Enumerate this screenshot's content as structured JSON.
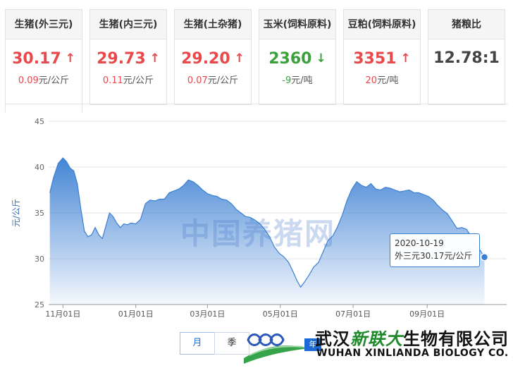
{
  "cards": [
    {
      "label": "生猪(外三元)",
      "price": "30.17",
      "direction": "up",
      "delta": "0.09",
      "unit": "元/公斤"
    },
    {
      "label": "生猪(内三元)",
      "price": "29.73",
      "direction": "up",
      "delta": "0.11",
      "unit": "元/公斤"
    },
    {
      "label": "生猪(土杂猪)",
      "price": "29.20",
      "direction": "up",
      "delta": "0.07",
      "unit": "元/公斤"
    },
    {
      "label": "玉米(饲料原料)",
      "price": "2360",
      "direction": "down",
      "delta": "-9",
      "unit": "元/吨"
    },
    {
      "label": "豆粕(饲料原料)",
      "price": "3351",
      "direction": "up",
      "delta": "20",
      "unit": "元/吨"
    },
    {
      "label": "猪粮比",
      "price": "12.78:1",
      "direction": "none",
      "delta": "",
      "unit": ""
    }
  ],
  "icons": {
    "up": "arrow-up-icon",
    "down": "arrow-down-icon"
  },
  "colors": {
    "up": "#e8494c",
    "down": "#3aa13c",
    "line": "#3b7fd3",
    "fill_top": "#3b7fd3",
    "fill_bottom": "#ffffff"
  },
  "watermark": "中国养猪网",
  "tooltip": {
    "date": "2020-10-19",
    "text": "外三元30.17元/公斤"
  },
  "periods": [
    {
      "label": "月",
      "active": true
    },
    {
      "label": "季",
      "active": false
    }
  ],
  "logo": {
    "cn_prefix": "武汉",
    "cn_brand": "新联大",
    "cn_suffix": "生物有限公司",
    "en": "WUHAN XINLIANDA BIOLOGY CO. ,LTD",
    "badge": "年"
  },
  "chart_data": {
    "type": "area",
    "ylabel": "元/公斤",
    "ylim": [
      25,
      45
    ],
    "yticks": [
      25,
      30,
      35,
      40,
      45
    ],
    "xticks": [
      {
        "label": "11月01日",
        "x": "2019-11-01"
      },
      {
        "label": "01月01日",
        "x": "2020-01-01"
      },
      {
        "label": "03月01日",
        "x": "2020-03-01"
      },
      {
        "label": "05月01日",
        "x": "2020-05-01"
      },
      {
        "label": "07月01日",
        "x": "2020-07-01"
      },
      {
        "label": "09月01日",
        "x": "2020-09-01"
      }
    ],
    "grid": true,
    "series": [
      {
        "name": "外三元",
        "points": [
          [
            "2019-10-21",
            37.2
          ],
          [
            "2019-10-24",
            38.8
          ],
          [
            "2019-10-28",
            40.4
          ],
          [
            "2019-11-01",
            41.0
          ],
          [
            "2019-11-04",
            40.6
          ],
          [
            "2019-11-07",
            39.9
          ],
          [
            "2019-11-10",
            39.6
          ],
          [
            "2019-11-13",
            38.2
          ],
          [
            "2019-11-16",
            35.4
          ],
          [
            "2019-11-19",
            33.0
          ],
          [
            "2019-11-22",
            32.4
          ],
          [
            "2019-11-25",
            32.6
          ],
          [
            "2019-11-28",
            33.4
          ],
          [
            "2019-12-01",
            32.6
          ],
          [
            "2019-12-04",
            32.2
          ],
          [
            "2019-12-07",
            33.6
          ],
          [
            "2019-12-10",
            35.0
          ],
          [
            "2019-12-13",
            34.6
          ],
          [
            "2019-12-16",
            33.9
          ],
          [
            "2019-12-19",
            33.4
          ],
          [
            "2019-12-22",
            33.8
          ],
          [
            "2019-12-25",
            33.7
          ],
          [
            "2019-12-28",
            33.9
          ],
          [
            "2020-01-01",
            33.8
          ],
          [
            "2020-01-05",
            34.3
          ],
          [
            "2020-01-09",
            36.0
          ],
          [
            "2020-01-13",
            36.4
          ],
          [
            "2020-01-17",
            36.3
          ],
          [
            "2020-01-21",
            36.5
          ],
          [
            "2020-01-25",
            36.5
          ],
          [
            "2020-01-29",
            37.2
          ],
          [
            "2020-02-02",
            37.4
          ],
          [
            "2020-02-06",
            37.6
          ],
          [
            "2020-02-10",
            38.0
          ],
          [
            "2020-02-14",
            38.6
          ],
          [
            "2020-02-18",
            38.4
          ],
          [
            "2020-02-22",
            38.0
          ],
          [
            "2020-02-26",
            37.5
          ],
          [
            "2020-03-01",
            37.1
          ],
          [
            "2020-03-05",
            36.9
          ],
          [
            "2020-03-09",
            36.8
          ],
          [
            "2020-03-13",
            36.5
          ],
          [
            "2020-03-17",
            36.4
          ],
          [
            "2020-03-21",
            36.0
          ],
          [
            "2020-03-25",
            35.4
          ],
          [
            "2020-03-29",
            35.0
          ],
          [
            "2020-04-02",
            34.6
          ],
          [
            "2020-04-06",
            34.5
          ],
          [
            "2020-04-10",
            34.2
          ],
          [
            "2020-04-14",
            33.8
          ],
          [
            "2020-04-18",
            33.2
          ],
          [
            "2020-04-22",
            32.4
          ],
          [
            "2020-04-26",
            31.3
          ],
          [
            "2020-04-30",
            30.6
          ],
          [
            "2020-05-04",
            30.2
          ],
          [
            "2020-05-08",
            29.6
          ],
          [
            "2020-05-12",
            28.5
          ],
          [
            "2020-05-15",
            27.6
          ],
          [
            "2020-05-18",
            26.9
          ],
          [
            "2020-05-21",
            27.4
          ],
          [
            "2020-05-25",
            28.2
          ],
          [
            "2020-05-29",
            29.1
          ],
          [
            "2020-06-02",
            29.6
          ],
          [
            "2020-06-06",
            30.8
          ],
          [
            "2020-06-10",
            32.0
          ],
          [
            "2020-06-14",
            32.5
          ],
          [
            "2020-06-18",
            33.5
          ],
          [
            "2020-06-22",
            34.8
          ],
          [
            "2020-06-26",
            36.4
          ],
          [
            "2020-06-30",
            37.6
          ],
          [
            "2020-07-04",
            38.4
          ],
          [
            "2020-07-08",
            38.0
          ],
          [
            "2020-07-12",
            37.8
          ],
          [
            "2020-07-16",
            38.2
          ],
          [
            "2020-07-20",
            37.6
          ],
          [
            "2020-07-24",
            37.5
          ],
          [
            "2020-07-28",
            37.8
          ],
          [
            "2020-08-01",
            37.7
          ],
          [
            "2020-08-05",
            37.5
          ],
          [
            "2020-08-09",
            37.3
          ],
          [
            "2020-08-13",
            37.4
          ],
          [
            "2020-08-17",
            37.5
          ],
          [
            "2020-08-21",
            37.2
          ],
          [
            "2020-08-25",
            37.2
          ],
          [
            "2020-08-29",
            37.0
          ],
          [
            "2020-09-02",
            36.8
          ],
          [
            "2020-09-06",
            36.4
          ],
          [
            "2020-09-10",
            35.8
          ],
          [
            "2020-09-14",
            35.3
          ],
          [
            "2020-09-18",
            34.9
          ],
          [
            "2020-09-22",
            34.1
          ],
          [
            "2020-09-26",
            33.3
          ],
          [
            "2020-09-30",
            33.4
          ],
          [
            "2020-10-04",
            33.2
          ],
          [
            "2020-10-08",
            32.4
          ],
          [
            "2020-10-12",
            31.5
          ],
          [
            "2020-10-16",
            30.8
          ],
          [
            "2020-10-19",
            30.17
          ]
        ]
      }
    ],
    "highlight": {
      "x": "2020-10-19",
      "y": 30.17
    }
  }
}
